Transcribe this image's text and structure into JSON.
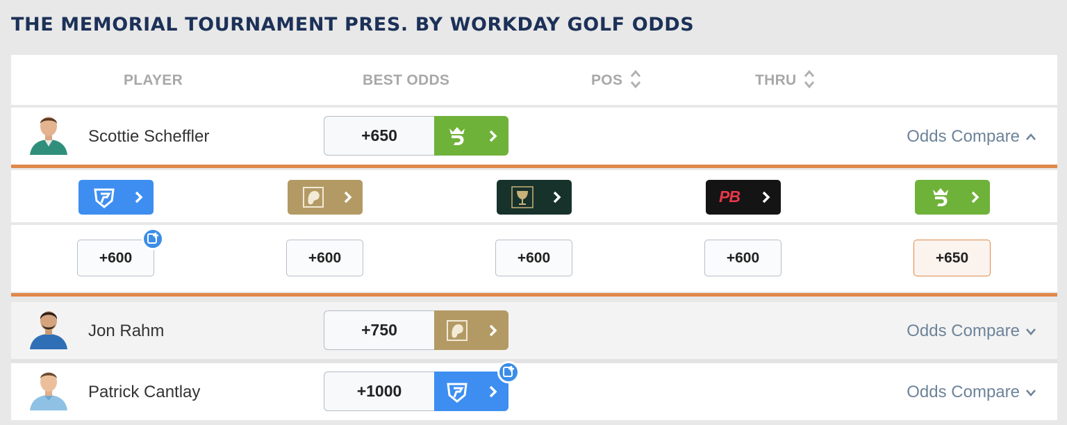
{
  "page_title": "THE MEMORIAL TOURNAMENT PRES. BY WORKDAY GOLF ODDS",
  "columns": {
    "player": "PLAYER",
    "best_odds": "BEST ODDS",
    "pos": "POS",
    "thru": "THRU"
  },
  "colors": {
    "fanduel": "#3d8ef0",
    "betmgm": "#b39a65",
    "caesars": "#17322b",
    "pointsbet": "#141414",
    "draftkings": "#6fb23a",
    "accent_orange": "#e0884a",
    "title_navy": "#1c3158"
  },
  "players": [
    {
      "name": "Scottie Scheffler",
      "best_odds": "+650",
      "best_book_icon": "draftkings-logo-icon",
      "odds_compare_label": "Odds Compare",
      "expanded": true
    },
    {
      "name": "Jon Rahm",
      "best_odds": "+750",
      "best_book_icon": "betmgm-logo-icon",
      "odds_compare_label": "Odds Compare",
      "expanded": false
    },
    {
      "name": "Patrick Cantlay",
      "best_odds": "+1000",
      "best_book_icon": "fanduel-logo-icon",
      "odds_compare_label": "Odds Compare",
      "expanded": false
    }
  ],
  "expanded_books": [
    {
      "book": "fanduel-logo-icon",
      "odds": "+600",
      "promo": true,
      "best": false
    },
    {
      "book": "betmgm-logo-icon",
      "odds": "+600",
      "promo": false,
      "best": false
    },
    {
      "book": "caesars-logo-icon",
      "odds": "+600",
      "promo": false,
      "best": false
    },
    {
      "book": "pointsbet-logo-icon",
      "odds": "+600",
      "promo": false,
      "best": false
    },
    {
      "book": "draftkings-logo-icon",
      "odds": "+650",
      "promo": false,
      "best": true
    }
  ],
  "pointsbet_logo_text": "PB"
}
